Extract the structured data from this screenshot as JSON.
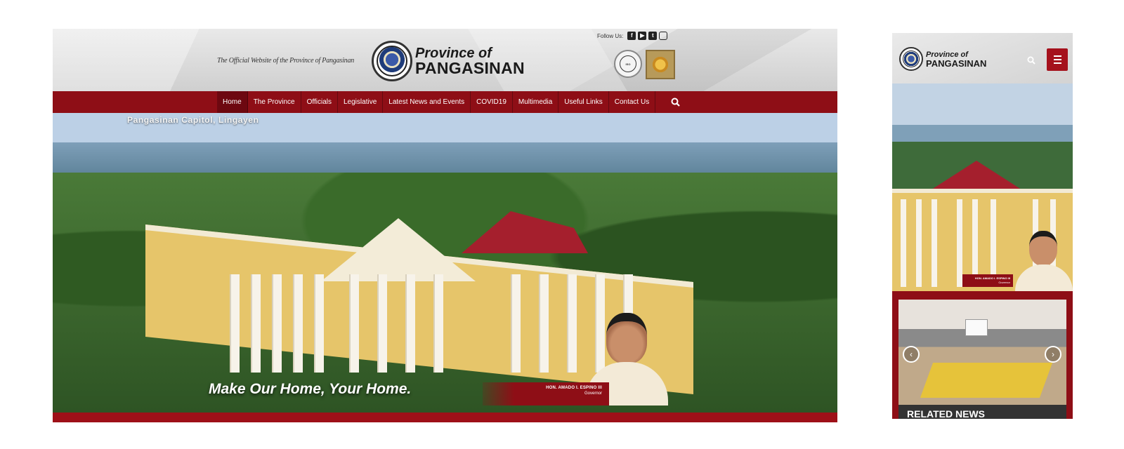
{
  "desktop": {
    "tagline": "The Official Website of the Province of Pangasinan",
    "brand": {
      "line1": "Province of",
      "line2": "PANGASINAN"
    },
    "follow_label": "Follow Us:",
    "social_icons": [
      "facebook-icon",
      "youtube-icon",
      "twitter-icon",
      "instagram-icon"
    ],
    "nav": [
      {
        "label": "Home",
        "active": true
      },
      {
        "label": "The Province"
      },
      {
        "label": "Officials"
      },
      {
        "label": "Legislative"
      },
      {
        "label": "Latest News and Events"
      },
      {
        "label": "COVID19"
      },
      {
        "label": "Multimedia"
      },
      {
        "label": "Useful Links"
      },
      {
        "label": "Contact Us"
      }
    ],
    "hero": {
      "caption": "Pangasinan Capitol, Lingayen",
      "slogan": "Make Our Home, Your Home.",
      "governor_name": "HON. AMADO I. ESPINO III",
      "governor_title": "Governor"
    }
  },
  "mobile": {
    "brand": {
      "line1": "Province of",
      "line2": "PANGASINAN"
    },
    "hero": {
      "governor_name": "HON. AMADO I. ESPINO III",
      "governor_title": "Governor"
    },
    "news_title": "RELATED NEWS"
  },
  "colors": {
    "brand_red": "#8e0e16",
    "active_nav": "#6d0810"
  }
}
